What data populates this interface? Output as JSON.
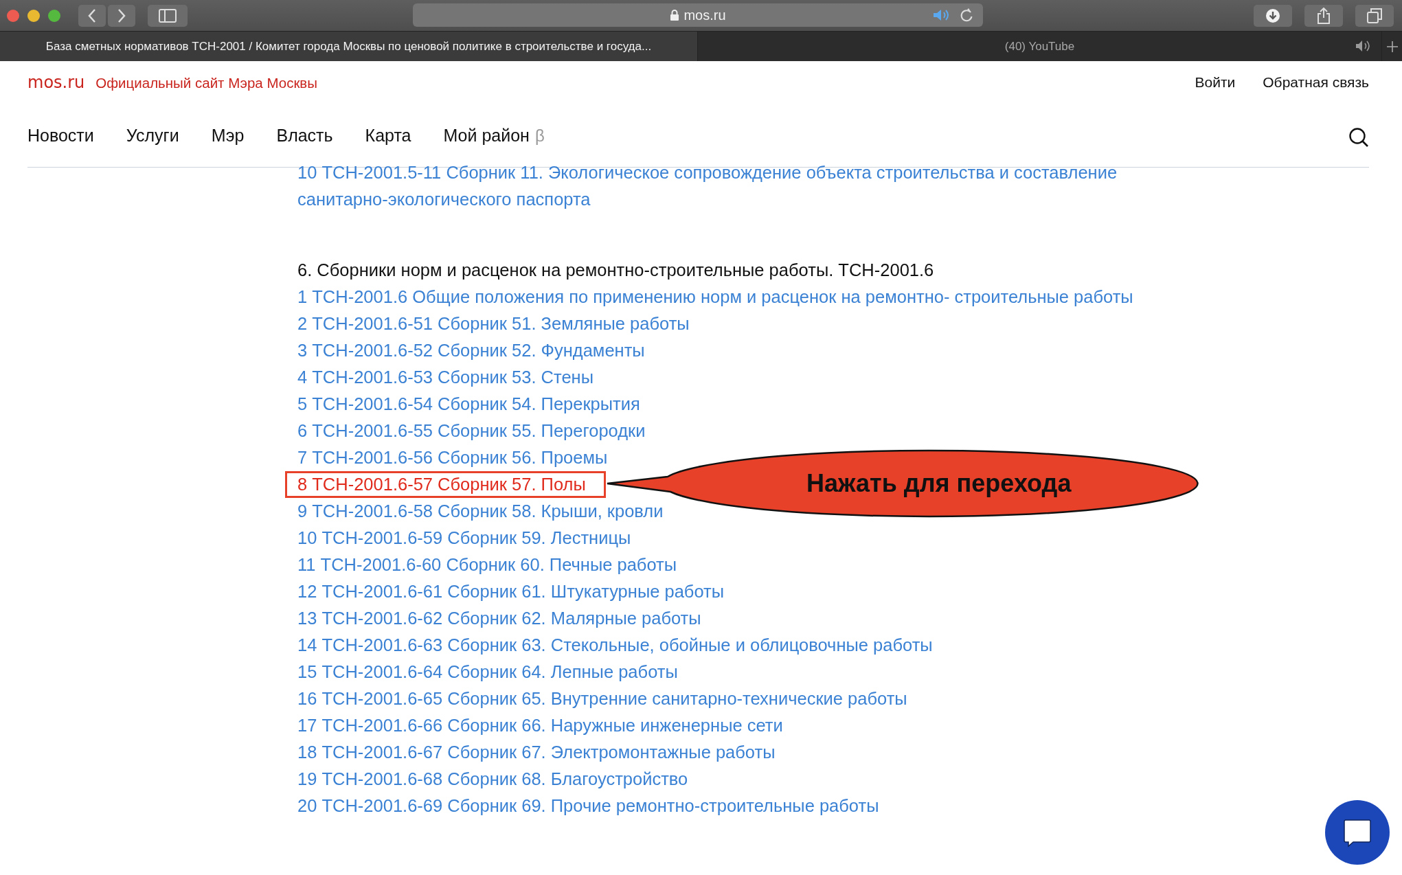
{
  "browser": {
    "address": "mos.ru",
    "tabs": [
      {
        "title": "База сметных нормативов ТСН-2001 / Комитет города Москвы по ценовой политике в строительстве и госуда...",
        "selected": true
      },
      {
        "title": "(40) YouTube",
        "selected": false
      }
    ]
  },
  "header": {
    "brand": "mos.ru",
    "tagline": "Официальный сайт Мэра Москвы",
    "actions": [
      "Войти",
      "Обратная связь"
    ]
  },
  "nav": [
    {
      "label": "Новости"
    },
    {
      "label": "Услуги"
    },
    {
      "label": "Мэр"
    },
    {
      "label": "Власть"
    },
    {
      "label": "Карта"
    },
    {
      "label": "Мой район",
      "badge": "β"
    }
  ],
  "sections": [
    {
      "items": [
        {
          "label": "10 ТСН-2001.5-11 Сборник 11. Экологическое сопровождение объекта строительства и составление санитарно-экологического паспорта",
          "highlighted": false
        }
      ]
    },
    {
      "heading": "6. Сборники норм и расценок на ремонтно-строительные работы. ТСН-2001.6",
      "items": [
        {
          "label": "1 ТСН-2001.6 Общие положения по применению норм и расценок на ремонтно- строительные работы",
          "highlighted": false
        },
        {
          "label": "2 ТСН-2001.6-51 Сборник 51. Земляные работы",
          "highlighted": false
        },
        {
          "label": "3 ТСН-2001.6-52 Сборник 52. Фундаменты",
          "highlighted": false
        },
        {
          "label": "4 ТСН-2001.6-53 Сборник 53. Стены",
          "highlighted": false
        },
        {
          "label": "5 ТСН-2001.6-54 Сборник 54. Перекрытия",
          "highlighted": false
        },
        {
          "label": "6 ТСН-2001.6-55 Сборник 55. Перегородки",
          "highlighted": false
        },
        {
          "label": "7 ТСН-2001.6-56 Сборник 56. Проемы",
          "highlighted": false
        },
        {
          "label": "8 ТСН-2001.6-57 Сборник 57. Полы",
          "highlighted": true
        },
        {
          "label": "9 ТСН-2001.6-58 Сборник 58. Крыши, кровли",
          "highlighted": false
        },
        {
          "label": "10 ТСН-2001.6-59 Сборник 59. Лестницы",
          "highlighted": false
        },
        {
          "label": "11 ТСН-2001.6-60 Сборник 60. Печные работы",
          "highlighted": false
        },
        {
          "label": "12 ТСН-2001.6-61 Сборник 61. Штукатурные работы",
          "highlighted": false
        },
        {
          "label": "13 ТСН-2001.6-62 Сборник 62. Малярные работы",
          "highlighted": false
        },
        {
          "label": "14 ТСН-2001.6-63 Сборник 63. Стекольные, обойные и облицовочные работы",
          "highlighted": false
        },
        {
          "label": "15 ТСН-2001.6-64 Сборник 64. Лепные работы",
          "highlighted": false
        },
        {
          "label": "16 ТСН-2001.6-65 Сборник 65. Внутренние санитарно-технические работы",
          "highlighted": false
        },
        {
          "label": "17 ТСН-2001.6-66 Сборник 66. Наружные инженерные сети",
          "highlighted": false
        },
        {
          "label": "18 ТСН-2001.6-67 Сборник 67. Электромонтажные работы",
          "highlighted": false
        },
        {
          "label": "19 ТСН-2001.6-68 Сборник 68. Благоустройство",
          "highlighted": false
        },
        {
          "label": "20 ТСН-2001.6-69 Сборник 69. Прочие ремонтно-строительные работы",
          "highlighted": false
        }
      ]
    }
  ],
  "callout": {
    "text": "Нажать для перехода"
  }
}
